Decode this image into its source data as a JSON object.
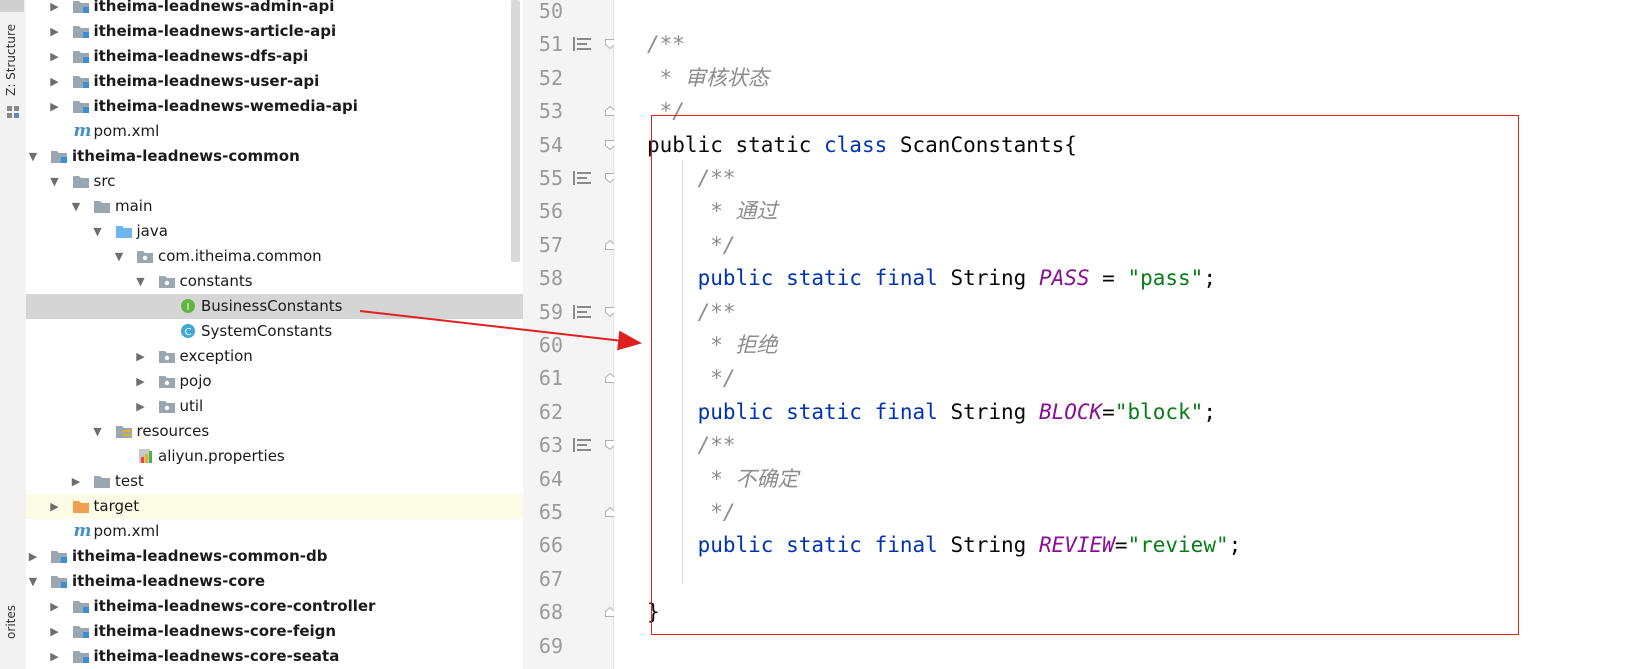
{
  "toolstrip": {
    "structure_label": "Z: Structure",
    "favorites_label": "orites"
  },
  "tree": [
    {
      "label": "itheima-leadnews-admin-api",
      "indent": 2,
      "arrow": "right",
      "icon": "module-folder",
      "bold": true
    },
    {
      "label": "itheima-leadnews-article-api",
      "indent": 2,
      "arrow": "right",
      "icon": "module-folder",
      "bold": true
    },
    {
      "label": "itheima-leadnews-dfs-api",
      "indent": 2,
      "arrow": "right",
      "icon": "module-folder",
      "bold": true
    },
    {
      "label": "itheima-leadnews-user-api",
      "indent": 2,
      "arrow": "right",
      "icon": "module-folder",
      "bold": true
    },
    {
      "label": "itheima-leadnews-wemedia-api",
      "indent": 2,
      "arrow": "right",
      "icon": "module-folder",
      "bold": true
    },
    {
      "label": "pom.xml",
      "indent": 2,
      "arrow": "none",
      "icon": "maven-file",
      "bold": false
    },
    {
      "label": "itheima-leadnews-common",
      "indent": 1,
      "arrow": "down",
      "icon": "module-folder",
      "bold": true
    },
    {
      "label": "src",
      "indent": 2,
      "arrow": "down",
      "icon": "folder",
      "bold": false
    },
    {
      "label": "main",
      "indent": 3,
      "arrow": "down",
      "icon": "folder",
      "bold": false
    },
    {
      "label": "java",
      "indent": 4,
      "arrow": "down",
      "icon": "source-folder",
      "bold": false
    },
    {
      "label": "com.itheima.common",
      "indent": 5,
      "arrow": "down",
      "icon": "package",
      "bold": false
    },
    {
      "label": "constants",
      "indent": 6,
      "arrow": "down",
      "icon": "package",
      "bold": false
    },
    {
      "label": "BusinessConstants",
      "indent": 7,
      "arrow": "none",
      "icon": "interface",
      "bold": false,
      "selected": true
    },
    {
      "label": "SystemConstants",
      "indent": 7,
      "arrow": "none",
      "icon": "class",
      "bold": false
    },
    {
      "label": "exception",
      "indent": 6,
      "arrow": "right",
      "icon": "package",
      "bold": false
    },
    {
      "label": "pojo",
      "indent": 6,
      "arrow": "right",
      "icon": "package",
      "bold": false
    },
    {
      "label": "util",
      "indent": 6,
      "arrow": "right",
      "icon": "package",
      "bold": false
    },
    {
      "label": "resources",
      "indent": 4,
      "arrow": "down",
      "icon": "resources-folder",
      "bold": false
    },
    {
      "label": "aliyun.properties",
      "indent": 5,
      "arrow": "none",
      "icon": "properties-file",
      "bold": false
    },
    {
      "label": "test",
      "indent": 3,
      "arrow": "right",
      "icon": "folder",
      "bold": false
    },
    {
      "label": "target",
      "indent": 2,
      "arrow": "right",
      "icon": "excluded-folder",
      "bold": false,
      "highlight": true
    },
    {
      "label": "pom.xml",
      "indent": 2,
      "arrow": "none",
      "icon": "maven-file",
      "bold": false
    },
    {
      "label": "itheima-leadnews-common-db",
      "indent": 1,
      "arrow": "right",
      "icon": "module-folder",
      "bold": true
    },
    {
      "label": "itheima-leadnews-core",
      "indent": 1,
      "arrow": "down",
      "icon": "module-folder",
      "bold": true
    },
    {
      "label": "itheima-leadnews-core-controller",
      "indent": 2,
      "arrow": "right",
      "icon": "module-folder",
      "bold": true
    },
    {
      "label": "itheima-leadnews-core-feign",
      "indent": 2,
      "arrow": "right",
      "icon": "module-folder",
      "bold": true
    },
    {
      "label": "itheima-leadnews-core-seata",
      "indent": 2,
      "arrow": "right",
      "icon": "module-folder",
      "bold": true
    }
  ],
  "gutter": {
    "lines": [
      "50",
      "51",
      "52",
      "53",
      "54",
      "55",
      "56",
      "57",
      "58",
      "59",
      "60",
      "61",
      "62",
      "63",
      "64",
      "65",
      "66",
      "67",
      "68",
      "69"
    ]
  },
  "code": [
    [],
    [
      {
        "t": "/**",
        "c": "cm"
      }
    ],
    [
      {
        "t": " * 审核状态",
        "c": "cm"
      }
    ],
    [
      {
        "t": " */",
        "c": "cm"
      }
    ],
    [
      {
        "t": "public static ",
        "c": ""
      },
      {
        "t": "class",
        "c": "kw"
      },
      {
        "t": " ScanConstants{",
        "c": ""
      }
    ],
    [
      {
        "t": "    /**",
        "c": "cm"
      }
    ],
    [
      {
        "t": "     * 通过",
        "c": "cm"
      }
    ],
    [
      {
        "t": "     */",
        "c": "cm"
      }
    ],
    [
      {
        "t": "    ",
        "c": ""
      },
      {
        "t": "public static final",
        "c": "kw"
      },
      {
        "t": " String ",
        "c": ""
      },
      {
        "t": "PASS",
        "c": "fld"
      },
      {
        "t": " = ",
        "c": ""
      },
      {
        "t": "\"pass\"",
        "c": "str"
      },
      {
        "t": ";",
        "c": ""
      }
    ],
    [
      {
        "t": "    /**",
        "c": "cm"
      }
    ],
    [
      {
        "t": "     * 拒绝",
        "c": "cm"
      }
    ],
    [
      {
        "t": "     */",
        "c": "cm"
      }
    ],
    [
      {
        "t": "    ",
        "c": ""
      },
      {
        "t": "public static final",
        "c": "kw"
      },
      {
        "t": " String ",
        "c": ""
      },
      {
        "t": "BLOCK",
        "c": "fld"
      },
      {
        "t": "=",
        "c": ""
      },
      {
        "t": "\"block\"",
        "c": "str"
      },
      {
        "t": ";",
        "c": ""
      }
    ],
    [
      {
        "t": "    /**",
        "c": "cm"
      }
    ],
    [
      {
        "t": "     * 不确定",
        "c": "cm"
      }
    ],
    [
      {
        "t": "     */",
        "c": "cm"
      }
    ],
    [
      {
        "t": "    ",
        "c": ""
      },
      {
        "t": "public static final",
        "c": "kw"
      },
      {
        "t": " String ",
        "c": ""
      },
      {
        "t": "REVIEW",
        "c": "fld"
      },
      {
        "t": "=",
        "c": ""
      },
      {
        "t": "\"review\"",
        "c": "str"
      },
      {
        "t": ";",
        "c": ""
      }
    ],
    [],
    [
      {
        "t": "}",
        "c": ""
      }
    ],
    []
  ],
  "colors": {
    "keyword": "#0033b3",
    "field": "#871094",
    "string": "#067d17",
    "comment": "#8c8c8c",
    "annotation_red": "#e02020"
  }
}
